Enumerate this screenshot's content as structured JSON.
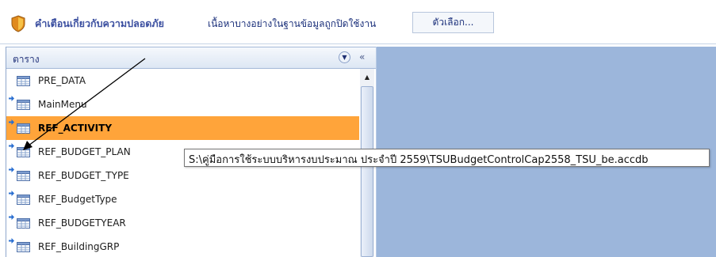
{
  "message_bar": {
    "icon": "shield-icon",
    "title": "คำเตือนเกี่ยวกับความปลอดภัย",
    "text": "เนื้อหาบางอย่างในฐานข้อมูลถูกปิดใช้งาน",
    "options_label": "ตัวเลือก..."
  },
  "nav_pane": {
    "title": "ตาราง",
    "menu_icon": "chevron-down-icon",
    "collapse_label": "«",
    "items": [
      {
        "label": "PRE_DATA",
        "linked": false,
        "selected": false
      },
      {
        "label": "MainMenu",
        "linked": true,
        "selected": false
      },
      {
        "label": "REF_ACTIVITY",
        "linked": true,
        "selected": true
      },
      {
        "label": "REF_BUDGET_PLAN",
        "linked": true,
        "selected": false
      },
      {
        "label": "REF_BUDGET_TYPE",
        "linked": true,
        "selected": false
      },
      {
        "label": "REF_BudgetType",
        "linked": true,
        "selected": false
      },
      {
        "label": "REF_BUDGETYEAR",
        "linked": true,
        "selected": false
      },
      {
        "label": "REF_BuildingGRP",
        "linked": true,
        "selected": false
      }
    ]
  },
  "tooltip": {
    "text": "S:\\คู่มือการใช้ระบบบริหารงบประมาณ ประจำปี 2559\\TSUBudgetControlCap2558_TSU_be.accdb"
  },
  "colors": {
    "selected_row": "#ffa43a",
    "main_area": "#9cb6db",
    "message_title": "#3b4fa0"
  }
}
